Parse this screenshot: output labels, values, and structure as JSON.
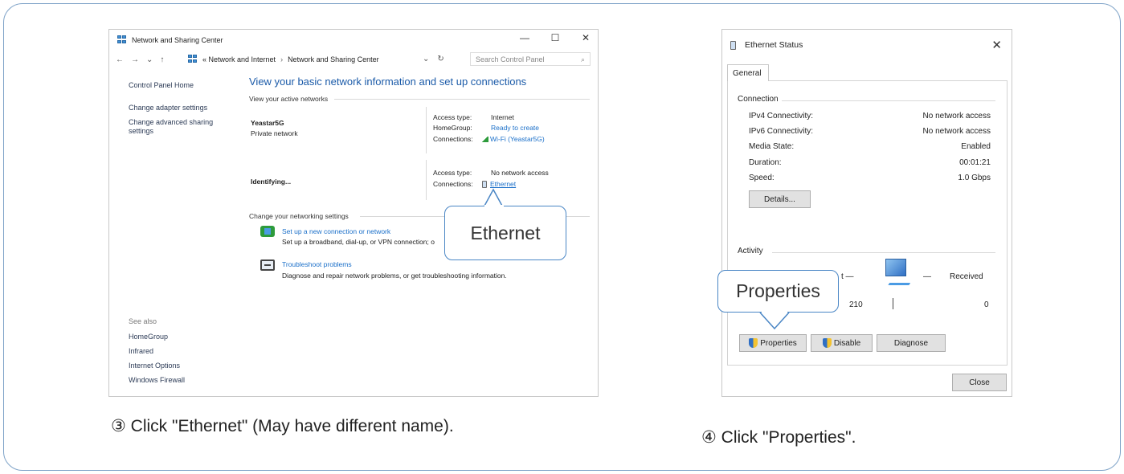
{
  "left_window": {
    "title": "Network and Sharing Center",
    "controls": {
      "minimize": "—",
      "maximize": "☐",
      "close": "✕"
    },
    "nav": {
      "back": "←",
      "forward": "→",
      "recent": "⌄",
      "up": "↑"
    },
    "address": {
      "crumb1": "«  Network and Internet",
      "sep": "›",
      "crumb2": "Network and Sharing Center",
      "dropdown": "⌄",
      "refresh": "↻"
    },
    "search_placeholder": "Search Control Panel",
    "search_icon": "⌕",
    "sidebar": {
      "home": "Control Panel Home",
      "adapter": "Change adapter settings",
      "advanced_1": "Change advanced sharing",
      "advanced_2": "settings",
      "see_also": "See also",
      "links": [
        "HomeGroup",
        "Infrared",
        "Internet Options",
        "Windows Firewall"
      ]
    },
    "heading": "View your basic network information and set up connections",
    "active_label": "View your active networks",
    "networks": [
      {
        "name": "Yeastar5G",
        "type": "Private network",
        "access_label": "Access type:",
        "access_value": "Internet",
        "homegroup_label": "HomeGroup:",
        "homegroup_value": "Ready to create",
        "connections_label": "Connections:",
        "connections_value": "Wi-Fi (Yeastar5G)"
      },
      {
        "name": "Identifying...",
        "access_label": "Access type:",
        "access_value": "No network access",
        "connections_label": "Connections:",
        "connections_value": "Ethernet"
      }
    ],
    "change_label": "Change your networking settings",
    "tasks": [
      {
        "title": "Set up a new connection or network",
        "desc": "Set up a broadband, dial-up, or VPN connection; o"
      },
      {
        "title": "Troubleshoot problems",
        "desc": "Diagnose and repair network problems, or get troubleshooting information."
      }
    ],
    "callout": "Ethernet"
  },
  "right_window": {
    "title": "Ethernet Status",
    "close": "✕",
    "tab": "General",
    "connection_group": "Connection",
    "rows": [
      {
        "label": "IPv4 Connectivity:",
        "value": "No network access"
      },
      {
        "label": "IPv6 Connectivity:",
        "value": "No network access"
      },
      {
        "label": "Media State:",
        "value": "Enabled"
      },
      {
        "label": "Duration:",
        "value": "00:01:21"
      },
      {
        "label": "Speed:",
        "value": "1.0 Gbps"
      }
    ],
    "details_button": "Details...",
    "activity_group": "Activity",
    "sent_tail": "t —",
    "received_label": "Received",
    "received_dash": "—",
    "sent_value": "210",
    "received_value": "0",
    "buttons": {
      "properties": "Properties",
      "disable": "Disable",
      "diagnose": "Diagnose",
      "close": "Close"
    },
    "callout": "Properties"
  },
  "captions": {
    "left": "③ Click \"Ethernet\" (May have different name).",
    "right": "④ Click \"Properties\"."
  },
  "colors": {
    "border_accent": "#7fa3c8",
    "callout_border": "#4a86c5",
    "link": "#1a6fc9",
    "heading": "#1a5aa8"
  }
}
